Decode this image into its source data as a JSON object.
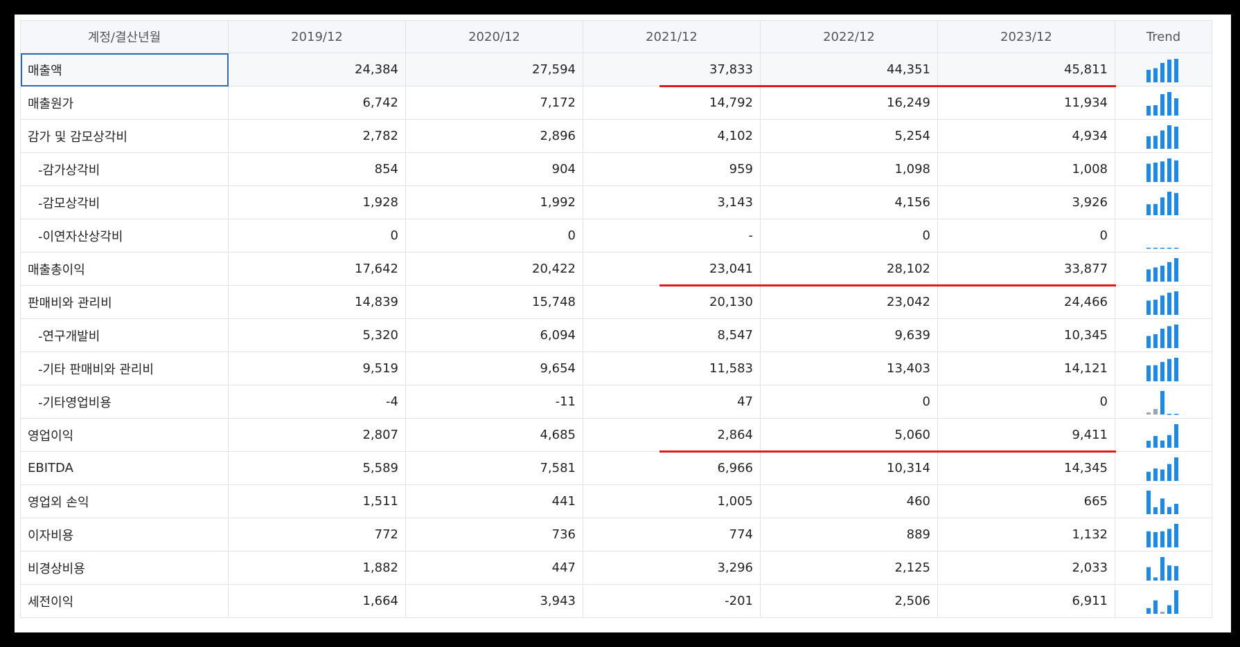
{
  "header": {
    "account_label": "계정/결산년월",
    "years": [
      "2019/12",
      "2020/12",
      "2021/12",
      "2022/12",
      "2023/12"
    ],
    "trend_label": "Trend"
  },
  "rows": [
    {
      "label": "매출액",
      "sub": false,
      "values": [
        "24,384",
        "27,594",
        "37,833",
        "44,351",
        "45,811"
      ],
      "trend": [
        24384,
        27594,
        37833,
        44351,
        45811
      ]
    },
    {
      "label": "매출원가",
      "sub": false,
      "values": [
        "6,742",
        "7,172",
        "14,792",
        "16,249",
        "11,934"
      ],
      "trend": [
        6742,
        7172,
        14792,
        16249,
        11934
      ]
    },
    {
      "label": "감가 및 감모상각비",
      "sub": false,
      "values": [
        "2,782",
        "2,896",
        "4,102",
        "5,254",
        "4,934"
      ],
      "trend": [
        2782,
        2896,
        4102,
        5254,
        4934
      ]
    },
    {
      "label": "-감가상각비",
      "sub": true,
      "values": [
        "854",
        "904",
        "959",
        "1,098",
        "1,008"
      ],
      "trend": [
        854,
        904,
        959,
        1098,
        1008
      ]
    },
    {
      "label": "-감모상각비",
      "sub": true,
      "values": [
        "1,928",
        "1,992",
        "3,143",
        "4,156",
        "3,926"
      ],
      "trend": [
        1928,
        1992,
        3143,
        4156,
        3926
      ]
    },
    {
      "label": "-이연자산상각비",
      "sub": true,
      "values": [
        "0",
        "0",
        "-",
        "0",
        "0"
      ],
      "trend": [
        0,
        0,
        0,
        0,
        0
      ]
    },
    {
      "label": "매출총이익",
      "sub": false,
      "values": [
        "17,642",
        "20,422",
        "23,041",
        "28,102",
        "33,877"
      ],
      "trend": [
        17642,
        20422,
        23041,
        28102,
        33877
      ]
    },
    {
      "label": "판매비와 관리비",
      "sub": false,
      "values": [
        "14,839",
        "15,748",
        "20,130",
        "23,042",
        "24,466"
      ],
      "trend": [
        14839,
        15748,
        20130,
        23042,
        24466
      ]
    },
    {
      "label": "-연구개발비",
      "sub": true,
      "values": [
        "5,320",
        "6,094",
        "8,547",
        "9,639",
        "10,345"
      ],
      "trend": [
        5320,
        6094,
        8547,
        9639,
        10345
      ]
    },
    {
      "label": "-기타 판매비와 관리비",
      "sub": true,
      "values": [
        "9,519",
        "9,654",
        "11,583",
        "13,403",
        "14,121"
      ],
      "trend": [
        9519,
        9654,
        11583,
        13403,
        14121
      ]
    },
    {
      "label": "-기타영업비용",
      "sub": true,
      "values": [
        "-4",
        "-11",
        "47",
        "0",
        "0"
      ],
      "trend": [
        -4,
        -11,
        47,
        0,
        0
      ]
    },
    {
      "label": "영업이익",
      "sub": false,
      "values": [
        "2,807",
        "4,685",
        "2,864",
        "5,060",
        "9,411"
      ],
      "trend": [
        2807,
        4685,
        2864,
        5060,
        9411
      ]
    },
    {
      "label": "EBITDA",
      "sub": false,
      "values": [
        "5,589",
        "7,581",
        "6,966",
        "10,314",
        "14,345"
      ],
      "trend": [
        5589,
        7581,
        6966,
        10314,
        14345
      ]
    },
    {
      "label": "영업외 손익",
      "sub": false,
      "values": [
        "1,511",
        "441",
        "1,005",
        "460",
        "665"
      ],
      "trend": [
        1511,
        441,
        1005,
        460,
        665
      ]
    },
    {
      "label": "이자비용",
      "sub": false,
      "values": [
        "772",
        "736",
        "774",
        "889",
        "1,132"
      ],
      "trend": [
        772,
        736,
        774,
        889,
        1132
      ]
    },
    {
      "label": "비경상비용",
      "sub": false,
      "values": [
        "1,882",
        "447",
        "3,296",
        "2,125",
        "2,033"
      ],
      "trend": [
        1882,
        447,
        3296,
        2125,
        2033
      ]
    },
    {
      "label": "세전이익",
      "sub": false,
      "values": [
        "1,664",
        "3,943",
        "-201",
        "2,506",
        "6,911"
      ],
      "trend": [
        1664,
        3943,
        -201,
        2506,
        6911
      ]
    }
  ],
  "highlight_rows": [
    "매출액",
    "매출총이익",
    "영업이익"
  ],
  "colors": {
    "bar": "#1e88e5",
    "bar_negative": "#9aa5b1",
    "highlight": "#e01818",
    "border": "#dfe3ea",
    "header_bg": "#f5f7fb"
  }
}
